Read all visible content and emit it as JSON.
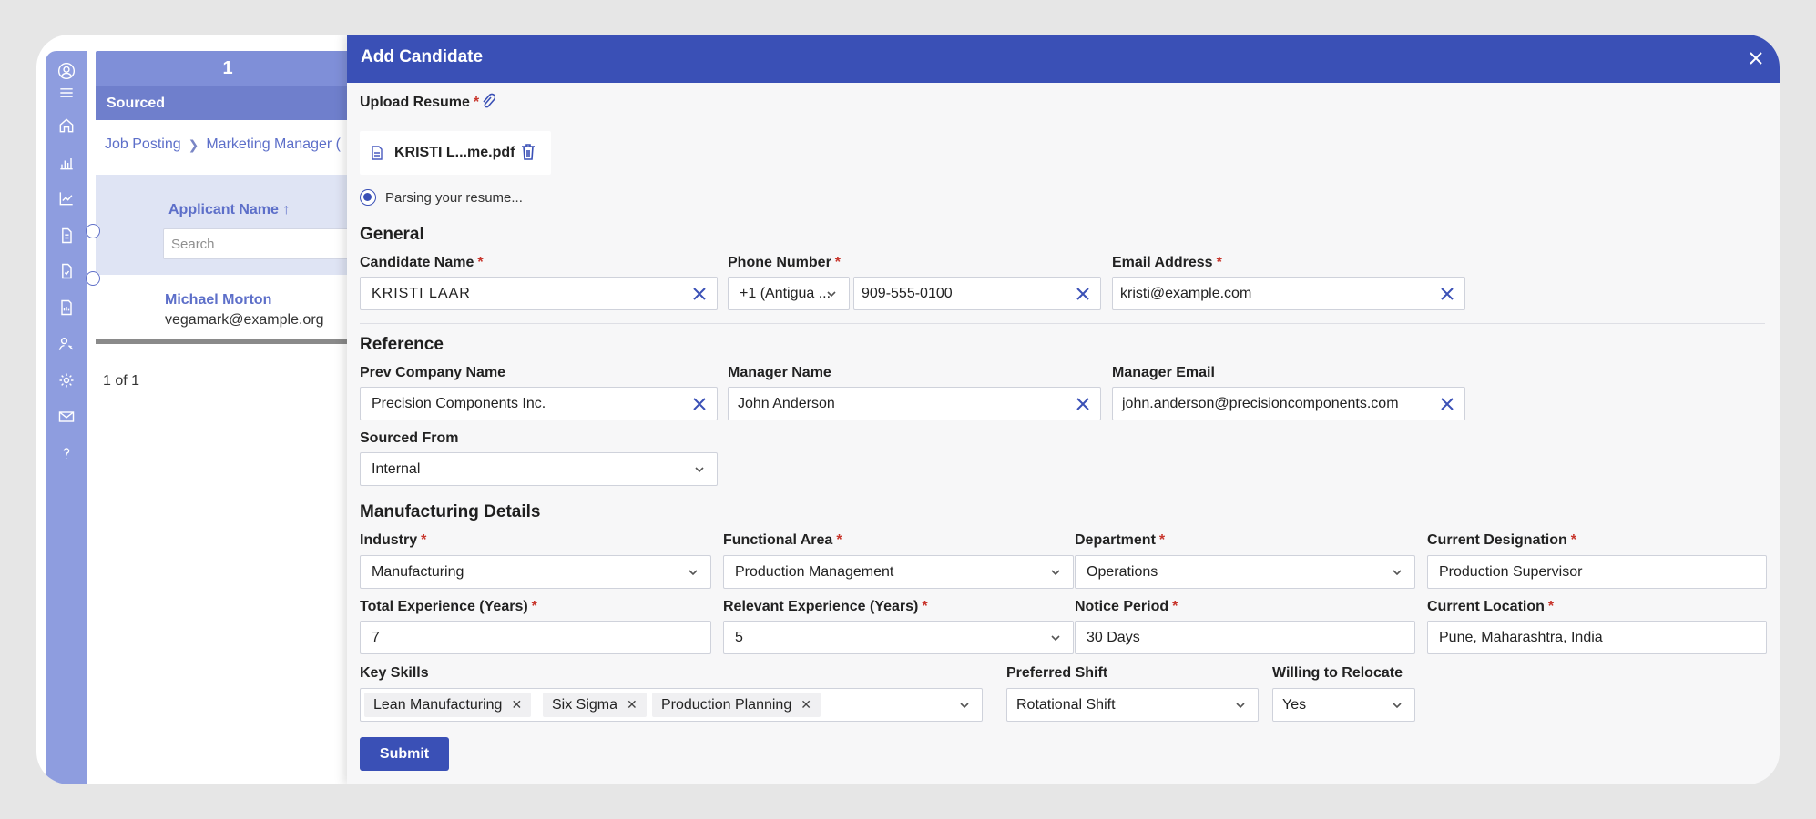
{
  "background": {
    "stage": {
      "count": "1",
      "label": "Sourced"
    },
    "breadcrumb": {
      "root": "Job Posting",
      "current": "Marketing Manager ("
    },
    "table": {
      "header": "Applicant Name ↑",
      "search_placeholder": "Search",
      "rows": [
        {
          "name": "Michael Morton",
          "email": "vegamark@example.org"
        }
      ],
      "pager": "1 of 1"
    }
  },
  "modal": {
    "title": "Add Candidate",
    "upload": {
      "label": "Upload Resume",
      "required": "*",
      "file_name": "KRISTI L...me.pdf",
      "status": "Parsing your resume..."
    },
    "general": {
      "heading": "General",
      "candidate_name": {
        "label": "Candidate Name",
        "value": "KRISTI LAAR"
      },
      "phone": {
        "label": "Phone Number",
        "country": "+1 (Antigua ...",
        "number": "909-555-0100"
      },
      "email": {
        "label": "Email Address",
        "value": "kristi@example.com"
      }
    },
    "reference": {
      "heading": "Reference",
      "prev_company": {
        "label": "Prev Company Name",
        "value": "Precision Components Inc."
      },
      "manager_name": {
        "label": "Manager Name",
        "value": "John Anderson"
      },
      "manager_email": {
        "label": "Manager Email",
        "value": "john.anderson@precisioncomponents.com"
      },
      "sourced_from": {
        "label": "Sourced From",
        "value": "Internal"
      }
    },
    "manufacturing": {
      "heading": "Manufacturing Details",
      "industry": {
        "label": "Industry",
        "value": "Manufacturing"
      },
      "functional_area": {
        "label": "Functional Area",
        "value": "Production Management"
      },
      "department": {
        "label": "Department",
        "value": "Operations"
      },
      "current_designation": {
        "label": "Current Designation",
        "value": "Production Supervisor"
      },
      "total_experience": {
        "label": "Total Experience (Years)",
        "value": "7"
      },
      "relevant_experience": {
        "label": "Relevant Experience (Years)",
        "value": "5"
      },
      "notice_period": {
        "label": "Notice Period",
        "value": "30 Days"
      },
      "current_location": {
        "label": "Current Location",
        "value": "Pune, Maharashtra, India"
      },
      "key_skills": {
        "label": "Key Skills",
        "chips": [
          "Lean Manufacturing",
          "Six Sigma",
          "Production Planning"
        ]
      },
      "preferred_shift": {
        "label": "Preferred Shift",
        "value": "Rotational Shift"
      },
      "relocate": {
        "label": "Willing to Relocate",
        "value": "Yes"
      }
    },
    "submit_label": "Submit"
  },
  "colors": {
    "accent": "#3a50b6",
    "rail": "#8e9ddf",
    "required": "#c8362d"
  },
  "rail_icons": [
    "user-avatar-icon",
    "menu-icon",
    "home-icon",
    "bar-chart-icon",
    "line-chart-icon",
    "document-icon",
    "document-check-icon",
    "report-icon",
    "user-key-icon",
    "gear-icon",
    "mail-icon",
    "help-icon"
  ]
}
